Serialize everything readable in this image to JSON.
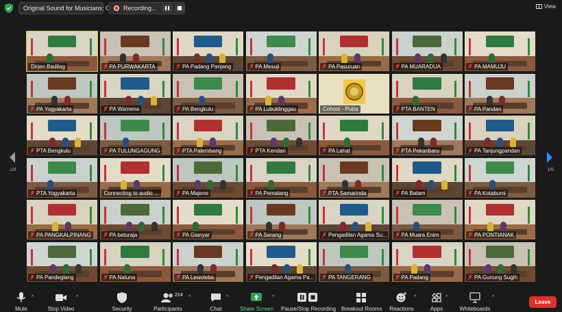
{
  "topbar": {
    "sound_label": "Original Sound for Musicians: On",
    "recording_label": "Recording...",
    "view_label": "View"
  },
  "pagination": {
    "left": "1/6",
    "right": "1/6"
  },
  "participants": [
    {
      "name": "Dirjen Badilag",
      "muted": false,
      "active": true
    },
    {
      "name": "PA PURWAKARTA",
      "muted": true
    },
    {
      "name": "PA Padang Panjang",
      "muted": true
    },
    {
      "name": "PA Mesuji",
      "muted": true
    },
    {
      "name": "PA Pasuruan",
      "muted": true
    },
    {
      "name": "PA MUARADUA",
      "muted": true
    },
    {
      "name": "PA MAMUJU",
      "muted": true
    },
    {
      "name": "PA Yogyakarta",
      "muted": true
    },
    {
      "name": "PA Wamena",
      "muted": true
    },
    {
      "name": "PA Bengkulu",
      "muted": true
    },
    {
      "name": "PA Lubuklinggau",
      "muted": true
    },
    {
      "name": "Cohost - Putra",
      "muted": false
    },
    {
      "name": "PTA BANTEN",
      "muted": true
    },
    {
      "name": "PA Pandan",
      "muted": true
    },
    {
      "name": "PTA Bengkulu",
      "muted": true
    },
    {
      "name": "PA TULUNGAGUNG",
      "muted": true
    },
    {
      "name": "PTA Palembang",
      "muted": true
    },
    {
      "name": "PTA Kendari",
      "muted": true
    },
    {
      "name": "PA Lahat",
      "muted": true
    },
    {
      "name": "PTA Pekanbaru",
      "muted": true
    },
    {
      "name": "PA Tanjungpandan",
      "muted": true
    },
    {
      "name": "PTA Yogyakarta",
      "muted": true
    },
    {
      "name": "Connecting to audio ...",
      "muted": false
    },
    {
      "name": "PA Majene",
      "muted": true
    },
    {
      "name": "PA Pemalang",
      "muted": true
    },
    {
      "name": "PTA Samarinda",
      "muted": true
    },
    {
      "name": "PA Batam",
      "muted": true
    },
    {
      "name": "PA Kotabumi",
      "muted": true
    },
    {
      "name": "PA PANGKALPINANG",
      "muted": true
    },
    {
      "name": "PA baturaja",
      "muted": true
    },
    {
      "name": "PA Gianyar",
      "muted": true
    },
    {
      "name": "PA Serang",
      "muted": true
    },
    {
      "name": "Pengadilan Agama Su...",
      "muted": true
    },
    {
      "name": "PA Muara Enim",
      "muted": true
    },
    {
      "name": "PA PONTIANAK",
      "muted": true
    },
    {
      "name": "PA Pandeglang",
      "muted": true
    },
    {
      "name": "PA Natuna",
      "muted": true
    },
    {
      "name": "PA Lewoleba",
      "muted": true
    },
    {
      "name": "Pengadilan Agama Pa...",
      "muted": true
    },
    {
      "name": "PA TANGERANG",
      "muted": true
    },
    {
      "name": "PA Padang",
      "muted": true
    },
    {
      "name": "PA Gunung Sugih",
      "muted": true
    }
  ],
  "toolbar": {
    "mute": "Mute",
    "stop_video": "Stop Video",
    "security": "Security",
    "participants": "Participants",
    "participants_count": "214",
    "chat": "Chat",
    "share_screen": "Share Screen",
    "pause_stop_recording": "Pause/Stop Recording",
    "breakout_rooms": "Breakout Rooms",
    "reactions": "Reactions",
    "apps": "Apps",
    "whiteboards": "Whiteboards",
    "leave": "Leave"
  },
  "colors": {
    "accent_green": "#2ea44f",
    "leave_red": "#d9322b",
    "active_speaker": "#d8c33a"
  }
}
